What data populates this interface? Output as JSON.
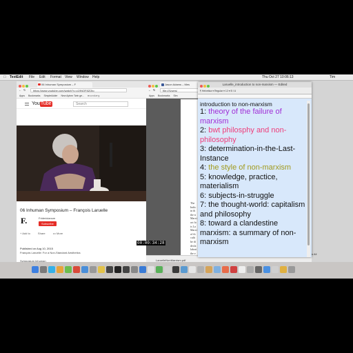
{
  "menubar": {
    "apple": "",
    "app": "TextEdit",
    "items": [
      "File",
      "Edit",
      "Format",
      "View",
      "Window",
      "Help"
    ],
    "clock": "Thu Oct 27  10:06:13",
    "right_label": "Tim"
  },
  "browser": {
    "tab_title": "06 Inhuman Symposium – F",
    "url": "https://www.youtube.com/watch?v=c19NOF8ZOto",
    "bookmarks": [
      "Apps",
      "Bookmarks",
      "SimpleAdder",
      "New Aphex Twin ge...",
      "m o n k e y"
    ],
    "search_placeholder": "Search",
    "video_title": "06 Inhuman Symposium – François Laruelle",
    "channel_logo": "F.",
    "channel_name": "Fridericianum",
    "subscribe": "Subscribe",
    "actions": [
      "+ Add to",
      "Share",
      "••• More"
    ],
    "published": "Published on Aug 10, 2015",
    "description": "François Laruelle: For a Non-Standard Aesthetics",
    "symposium": "Symposium Inhuman",
    "timecode": "00:00:34:28"
  },
  "yt_logo": {
    "you": "You",
    "tube": "Tube"
  },
  "fbwin": {
    "tab_title": "Jason Adams – Mes",
    "url": "file:///Users/",
    "bookmarks": [
      "Apps",
      "Bookmarks",
      "Sim"
    ],
    "bookmark_tail": "School",
    "pdf_title": "The",
    "pdf_lines": "The\nIndic\nin th\nthe n\nMarxi\nact fo\nis La\nMarxi\nof th\nculti\nhe di\ndecla\nlabori\nthe e",
    "download_file": "LaruelleNonMarxism.pdf",
    "show_all": "Show All"
  },
  "textedit": {
    "title": "Laruelle_introduction to non-marxism — Edited",
    "toolbar": "¶  Helvetica  ▾  Regular ▾  12 ▾  B I U",
    "heading": "introduction to non-marxism",
    "items": [
      {
        "num": "1: ",
        "text": "theory of the failure of marxism",
        "color": "#a02dd6"
      },
      {
        "num": "2: ",
        "text": "bwt philosphy and non-philosophy",
        "color": "#ee3d7a"
      },
      {
        "num": "3: ",
        "text": "determination-in-the-Last-Instance",
        "color": "#111111"
      },
      {
        "num": "4: ",
        "text": "the style of non-marxism",
        "color": "#a19a1c"
      },
      {
        "num": "5: ",
        "text": "knowledge, practice, materialism",
        "color": "#111111"
      },
      {
        "num": "6: ",
        "text": "subjects-in-struggle",
        "color": "#111111"
      },
      {
        "num": "7: ",
        "text": "the thought-world: capitalism and philosophy",
        "color": "#111111"
      },
      {
        "num": "8: ",
        "text": "toward a clandestine marxism: a summary of non-marxism",
        "color": "#111111"
      }
    ]
  }
}
